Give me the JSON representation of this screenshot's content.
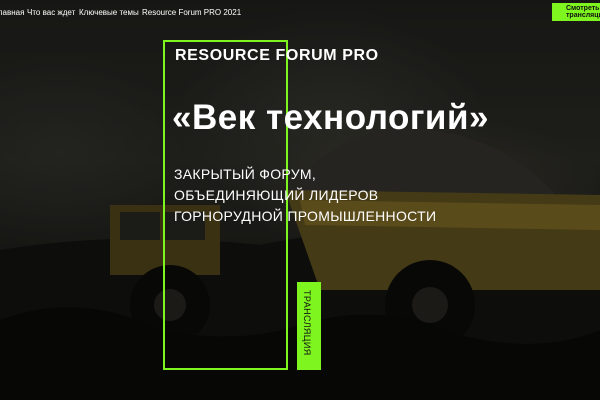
{
  "nav": {
    "home_label": "Главная",
    "expect_label": "Что вас ждет",
    "topics_label": "Ключевые темы",
    "pro_label": "Resource Forum PRO 2021",
    "watch_label": "Смотреть трансляцию"
  },
  "hero": {
    "brand": "RESOURCE FORUM PRO",
    "headline": "«Век технологий»",
    "subtitle_lines": [
      "ЗАКРЫТЫЙ ФОРУМ,",
      "ОБЪЕДИНЯЮЩИЙ ЛИДЕРОВ",
      "ГОРНОРУДНОЙ ПРОМЫШЛЕННОСТИ"
    ],
    "broadcast_label": "ТРАНСЛЯЦИЯ"
  },
  "colors": {
    "accent": "#7ef51e",
    "text": "#ffffff",
    "background": "#1a1a18"
  }
}
